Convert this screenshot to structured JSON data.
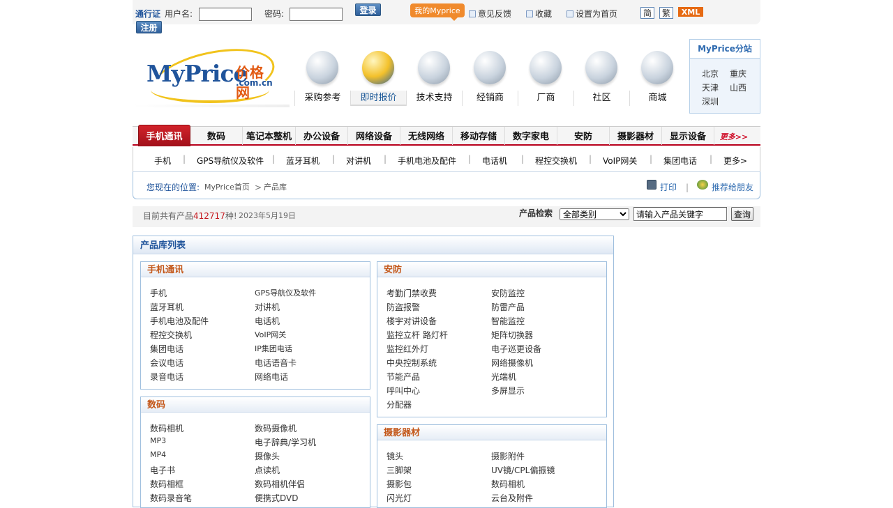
{
  "topbar": {
    "pass_label": "通行证",
    "username_label": "用户名:",
    "password_label": "密码:",
    "login_button": "登录",
    "register_button": "注册",
    "my_myprice": "我的Myprice",
    "feedback": "意见反馈",
    "favorite": "收藏",
    "homepage": "设置为首页",
    "simplified": "简",
    "traditional": "繁",
    "xml": "XML"
  },
  "logo": {
    "brand": "MyPrice",
    "cn": "价格网",
    "domain": ".com.cn"
  },
  "nav": [
    {
      "label": "采购参考",
      "icon": "shopping-guide-icon"
    },
    {
      "label": "即时报价",
      "icon": "quote-icon",
      "active": true
    },
    {
      "label": "技术支持",
      "icon": "tools-icon"
    },
    {
      "label": "经销商",
      "icon": "book-icon"
    },
    {
      "label": "厂商",
      "icon": "globe-icon"
    },
    {
      "label": "社区",
      "icon": "community-icon"
    },
    {
      "label": "商城",
      "icon": "mall-icon"
    }
  ],
  "branch": {
    "title": "MyPrice分站",
    "cities": [
      "北京",
      "重庆",
      "天津",
      "山西",
      "深圳"
    ]
  },
  "categories": [
    "手机通讯",
    "数码",
    "笔记本整机",
    "办公设备",
    "网络设备",
    "无线网络",
    "移动存储",
    "数字家电",
    "安防",
    "摄影器材",
    "显示设备",
    "更多>>"
  ],
  "subcategories": [
    "手机",
    "GPS导航仪及软件",
    "蓝牙耳机",
    "对讲机",
    "手机电池及配件",
    "电话机",
    "程控交换机",
    "VoIP网关",
    "集团电话",
    "更多>"
  ],
  "breadcrumb": {
    "label": "您现在的位置:",
    "home": "MyPrice首页",
    "arrow": ">",
    "current": "产品库",
    "print": "打印",
    "recommend": "推荐给朋友",
    "divider": "|"
  },
  "stats": {
    "prefix": "目前共有产品",
    "count": "412717",
    "suffix": "种!",
    "date": "2023年5月19日"
  },
  "search": {
    "label": "产品检索",
    "category": "全部类别",
    "placeholder": "请输入产品关键字",
    "button": "查询"
  },
  "list": {
    "title": "产品库列表",
    "sections": [
      {
        "title": "手机通讯",
        "items": [
          "手机",
          "GPS导航仪及软件",
          "蓝牙耳机",
          "对讲机",
          "手机电池及配件",
          "电话机",
          "程控交换机",
          "VoIP网关",
          "集团电话",
          "IP集团电话",
          "会议电话",
          "电话语音卡",
          "录音电话",
          "网络电话"
        ]
      },
      {
        "title": "安防",
        "items": [
          "考勤门禁收费",
          "安防监控",
          "防盗报警",
          "防雷产品",
          "楼宇对讲设备",
          "智能监控",
          "监控立杆 路灯杆",
          "矩阵切换器",
          "监控红外灯",
          "电子巡更设备",
          "中央控制系统",
          "网络摄像机",
          "节能产品",
          "光端机",
          "呼叫中心",
          "多屏显示",
          "分配器"
        ]
      },
      {
        "title": "数码",
        "items": [
          "数码相机",
          "数码摄像机",
          "MP3",
          "电子辞典/学习机",
          "MP4",
          "摄像头",
          "电子书",
          "点读机",
          "数码相框",
          "数码相机伴侣",
          "数码录音笔",
          "便携式DVD"
        ]
      },
      {
        "title": "摄影器材",
        "items": [
          "镜头",
          "摄影附件",
          "三脚架",
          "UV镜/CPL偏振镜",
          "摄影包",
          "数码相机",
          "闪光灯",
          "云台及附件"
        ]
      }
    ]
  }
}
